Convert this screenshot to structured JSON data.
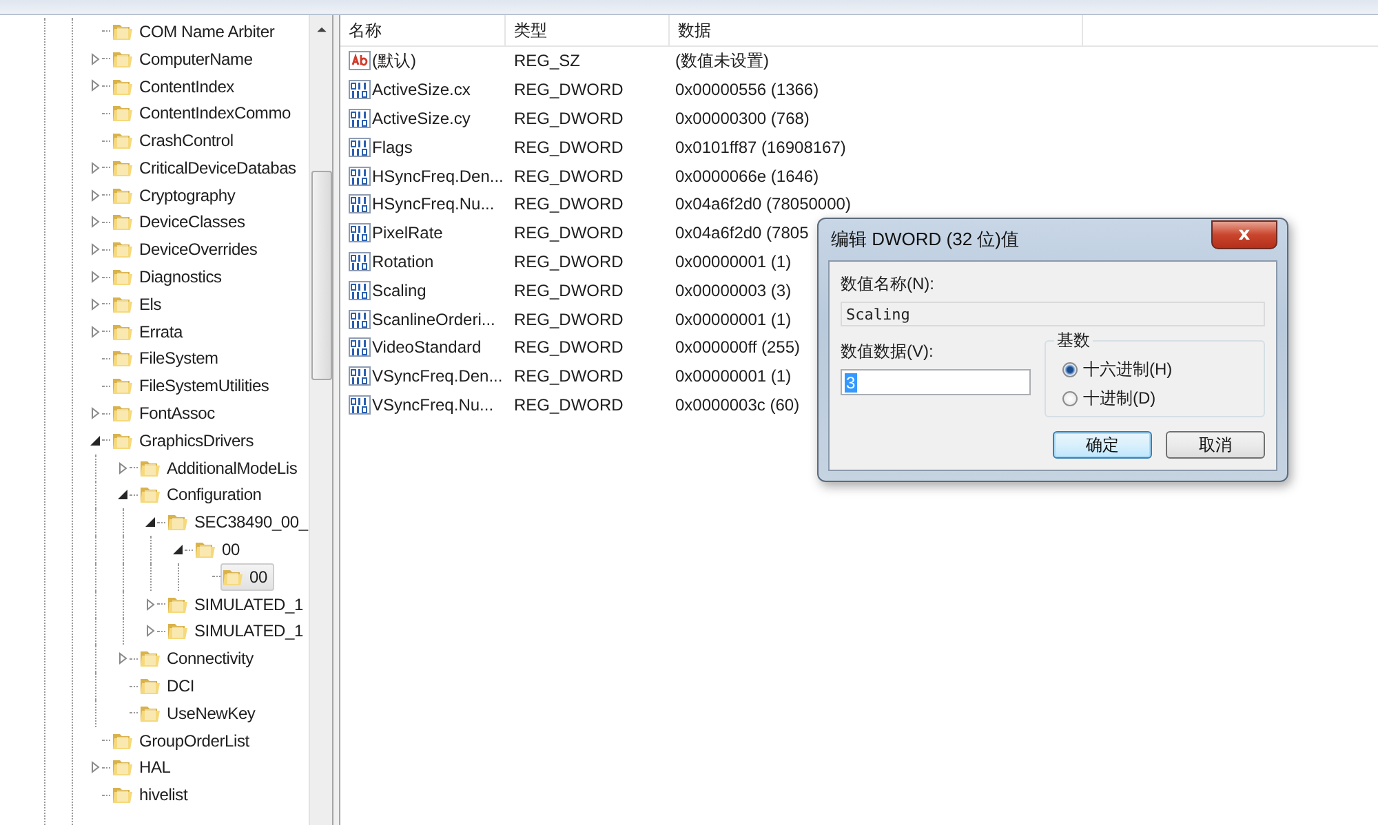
{
  "tree": {
    "items": [
      {
        "label": "COM Name Arbiter",
        "selected": false
      },
      {
        "label": "ComputerName",
        "expanded": false,
        "selected": false
      },
      {
        "label": "ContentIndex",
        "expanded": false,
        "selected": false
      },
      {
        "label": "ContentIndexCommo",
        "selected": false
      },
      {
        "label": "CrashControl",
        "selected": false
      },
      {
        "label": "CriticalDeviceDatabas",
        "expanded": false,
        "selected": false
      },
      {
        "label": "Cryptography",
        "expanded": false,
        "selected": false
      },
      {
        "label": "DeviceClasses",
        "expanded": false,
        "selected": false
      },
      {
        "label": "DeviceOverrides",
        "expanded": false,
        "selected": false
      },
      {
        "label": "Diagnostics",
        "expanded": false,
        "selected": false
      },
      {
        "label": "Els",
        "expanded": false,
        "selected": false
      },
      {
        "label": "Errata",
        "expanded": false,
        "selected": false
      },
      {
        "label": "FileSystem",
        "selected": false
      },
      {
        "label": "FileSystemUtilities",
        "selected": false
      },
      {
        "label": "FontAssoc",
        "expanded": false,
        "selected": false
      },
      {
        "label": "GraphicsDrivers",
        "expanded": true,
        "selected": false,
        "children": [
          {
            "label": "AdditionalModeLis",
            "expanded": false,
            "selected": false
          },
          {
            "label": "Configuration",
            "expanded": true,
            "selected": false,
            "children": [
              {
                "label": "SEC38490_00_",
                "expanded": true,
                "selected": false,
                "children": [
                  {
                    "label": "00",
                    "expanded": true,
                    "selected": false,
                    "children": [
                      {
                        "label": "00",
                        "selected": true
                      }
                    ]
                  }
                ]
              },
              {
                "label": "SIMULATED_1",
                "expanded": false,
                "selected": false
              },
              {
                "label": "SIMULATED_1",
                "expanded": false,
                "selected": false
              }
            ]
          },
          {
            "label": "Connectivity",
            "expanded": false,
            "selected": false
          },
          {
            "label": "DCI",
            "selected": false
          },
          {
            "label": "UseNewKey",
            "selected": false
          }
        ]
      },
      {
        "label": "GroupOrderList",
        "selected": false
      },
      {
        "label": "HAL",
        "expanded": false,
        "selected": false
      },
      {
        "label": "hivelist",
        "selected": false
      }
    ]
  },
  "values": {
    "columns": [
      "名称",
      "类型",
      "数据"
    ],
    "rows": [
      {
        "kind": "string",
        "name": "(默认)",
        "type": "REG_SZ",
        "data": "(数值未设置)"
      },
      {
        "kind": "dword",
        "name": "ActiveSize.cx",
        "type": "REG_DWORD",
        "data": "0x00000556 (1366)"
      },
      {
        "kind": "dword",
        "name": "ActiveSize.cy",
        "type": "REG_DWORD",
        "data": "0x00000300 (768)"
      },
      {
        "kind": "dword",
        "name": "Flags",
        "type": "REG_DWORD",
        "data": "0x0101ff87 (16908167)"
      },
      {
        "kind": "dword",
        "name": "HSyncFreq.Den...",
        "type": "REG_DWORD",
        "data": "0x0000066e (1646)"
      },
      {
        "kind": "dword",
        "name": "HSyncFreq.Nu...",
        "type": "REG_DWORD",
        "data": "0x04a6f2d0 (78050000)"
      },
      {
        "kind": "dword",
        "name": "PixelRate",
        "type": "REG_DWORD",
        "data": "0x04a6f2d0 (7805"
      },
      {
        "kind": "dword",
        "name": "Rotation",
        "type": "REG_DWORD",
        "data": "0x00000001 (1)"
      },
      {
        "kind": "dword",
        "name": "Scaling",
        "type": "REG_DWORD",
        "data": "0x00000003 (3)"
      },
      {
        "kind": "dword",
        "name": "ScanlineOrderi...",
        "type": "REG_DWORD",
        "data": "0x00000001 (1)"
      },
      {
        "kind": "dword",
        "name": "VideoStandard",
        "type": "REG_DWORD",
        "data": "0x000000ff (255)"
      },
      {
        "kind": "dword",
        "name": "VSyncFreq.Den...",
        "type": "REG_DWORD",
        "data": "0x00000001 (1)"
      },
      {
        "kind": "dword",
        "name": "VSyncFreq.Nu...",
        "type": "REG_DWORD",
        "data": "0x0000003c (60)"
      }
    ]
  },
  "dialog": {
    "title": "编辑 DWORD (32 位)值",
    "close": "x",
    "name_label": "数值名称(N):",
    "name_value": "Scaling",
    "data_label": "数值数据(V):",
    "data_value": "3",
    "base_label": "基数",
    "bases": [
      {
        "label": "十六进制(H)",
        "selected": true
      },
      {
        "label": "十进制(D)",
        "selected": false
      }
    ],
    "buttons": [
      {
        "label": "确定",
        "default": true
      },
      {
        "label": "取消",
        "default": false
      }
    ]
  }
}
